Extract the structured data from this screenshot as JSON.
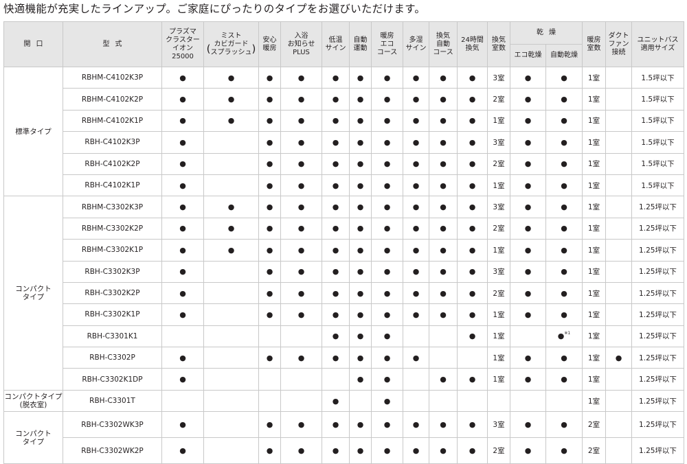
{
  "heading": "快適機能が充実したラインアップ。ご家庭にぴったりのタイプをお選びいただけます。",
  "columns": {
    "opening": [
      "開",
      "口"
    ],
    "model": [
      "型",
      "式"
    ],
    "plasma": [
      "プラズマ",
      "クラスター",
      "イオン",
      "25000"
    ],
    "mist": [
      "ミスト",
      "カビガード",
      "スプラッシュ"
    ],
    "anshin": [
      "安心",
      "暖房"
    ],
    "bath": [
      "入浴",
      "お知らせ",
      "PLUS"
    ],
    "low_temp": [
      "低温",
      "サイン"
    ],
    "auto": [
      "自動",
      "運動"
    ],
    "heat_eco": [
      "暖房",
      "エコ",
      "コース"
    ],
    "humid": [
      "多湿",
      "サイン"
    ],
    "vent_auto": [
      "換気",
      "自動",
      "コース"
    ],
    "vent24": [
      "24時間",
      "換気"
    ],
    "vent_rooms": [
      "換気",
      "室数"
    ],
    "dry": [
      "乾",
      "燥"
    ],
    "dry_eco": "エコ乾燥",
    "dry_auto": "自動乾燥",
    "heat_rooms": [
      "暖房",
      "室数"
    ],
    "duct": [
      "ダクト",
      "ファン",
      "接続"
    ],
    "size": [
      "ユニットバス",
      "適用サイズ"
    ]
  },
  "paren": [
    "(",
    ")"
  ],
  "dot": "●",
  "note_mark": "※1",
  "groups": [
    {
      "name": [
        "標準タイプ"
      ],
      "rows": [
        {
          "model": "RBHM-C4102K3P",
          "c": [
            "●",
            "●",
            "●",
            "●",
            "●",
            "●",
            "●",
            "●",
            "●",
            "●",
            "3室",
            "●",
            "●",
            "1室",
            "",
            "1.5坪以下"
          ]
        },
        {
          "model": "RBHM-C4102K2P",
          "c": [
            "●",
            "●",
            "●",
            "●",
            "●",
            "●",
            "●",
            "●",
            "●",
            "●",
            "2室",
            "●",
            "●",
            "1室",
            "",
            "1.5坪以下"
          ]
        },
        {
          "model": "RBHM-C4102K1P",
          "c": [
            "●",
            "●",
            "●",
            "●",
            "●",
            "●",
            "●",
            "●",
            "●",
            "●",
            "1室",
            "●",
            "●",
            "1室",
            "",
            "1.5坪以下"
          ]
        },
        {
          "model": "RBH-C4102K3P",
          "c": [
            "●",
            "",
            "●",
            "●",
            "●",
            "●",
            "●",
            "●",
            "●",
            "●",
            "3室",
            "●",
            "●",
            "1室",
            "",
            "1.5坪以下"
          ]
        },
        {
          "model": "RBH-C4102K2P",
          "c": [
            "●",
            "",
            "●",
            "●",
            "●",
            "●",
            "●",
            "●",
            "●",
            "●",
            "2室",
            "●",
            "●",
            "1室",
            "",
            "1.5坪以下"
          ]
        },
        {
          "model": "RBH-C4102K1P",
          "c": [
            "●",
            "",
            "●",
            "●",
            "●",
            "●",
            "●",
            "●",
            "●",
            "●",
            "1室",
            "●",
            "●",
            "1室",
            "",
            "1.5坪以下"
          ]
        }
      ]
    },
    {
      "name": [
        "コンパクト",
        "タイプ"
      ],
      "rows": [
        {
          "model": "RBHM-C3302K3P",
          "c": [
            "●",
            "●",
            "●",
            "●",
            "●",
            "●",
            "●",
            "●",
            "●",
            "●",
            "3室",
            "●",
            "●",
            "1室",
            "",
            "1.25坪以下"
          ]
        },
        {
          "model": "RBHM-C3302K2P",
          "c": [
            "●",
            "●",
            "●",
            "●",
            "●",
            "●",
            "●",
            "●",
            "●",
            "●",
            "2室",
            "●",
            "●",
            "1室",
            "",
            "1.25坪以下"
          ]
        },
        {
          "model": "RBHM-C3302K1P",
          "c": [
            "●",
            "●",
            "●",
            "●",
            "●",
            "●",
            "●",
            "●",
            "●",
            "●",
            "1室",
            "●",
            "●",
            "1室",
            "",
            "1.25坪以下"
          ]
        },
        {
          "model": "RBH-C3302K3P",
          "c": [
            "●",
            "",
            "●",
            "●",
            "●",
            "●",
            "●",
            "●",
            "●",
            "●",
            "3室",
            "●",
            "●",
            "1室",
            "",
            "1.25坪以下"
          ]
        },
        {
          "model": "RBH-C3302K2P",
          "c": [
            "●",
            "",
            "●",
            "●",
            "●",
            "●",
            "●",
            "●",
            "●",
            "●",
            "2室",
            "●",
            "●",
            "1室",
            "",
            "1.25坪以下"
          ]
        },
        {
          "model": "RBH-C3302K1P",
          "c": [
            "●",
            "",
            "●",
            "●",
            "●",
            "●",
            "●",
            "●",
            "●",
            "●",
            "1室",
            "●",
            "●",
            "1室",
            "",
            "1.25坪以下"
          ]
        },
        {
          "model": "RBH-C3301K1",
          "c": [
            "",
            "",
            "",
            "",
            "●",
            "●",
            "●",
            "",
            "",
            "●",
            "1室",
            "",
            "●",
            "1室",
            "",
            "1.25坪以下"
          ],
          "note_col": 12
        },
        {
          "model": "RBH-C3302P",
          "c": [
            "●",
            "",
            "●",
            "●",
            "●",
            "●",
            "●",
            "●",
            "",
            "",
            "1室",
            "●",
            "●",
            "1室",
            "●",
            "1.25坪以下"
          ]
        },
        {
          "model": "RBH-C3302K1DP",
          "c": [
            "●",
            "",
            "",
            "",
            "",
            "●",
            "●",
            "",
            "●",
            "●",
            "1室",
            "●",
            "●",
            "1室",
            "",
            "1.25坪以下"
          ]
        }
      ]
    },
    {
      "name": [
        "コンパクトタイプ",
        "(脱衣室)"
      ],
      "rows": [
        {
          "model": "RBH-C3301T",
          "c": [
            "",
            "",
            "",
            "",
            "●",
            "",
            "●",
            "",
            "",
            "",
            "",
            "",
            "",
            "1室",
            "",
            "1.25坪以下"
          ]
        }
      ]
    },
    {
      "name": [
        "コンパクト",
        "タイプ"
      ],
      "rows": [
        {
          "model": "RBH-C3302WK3P",
          "c": [
            "●",
            "",
            "●",
            "●",
            "●",
            "●",
            "●",
            "●",
            "●",
            "●",
            "3室",
            "●",
            "●",
            "2室",
            "",
            "1.25坪以下"
          ]
        },
        {
          "model": "RBH-C3302WK2P",
          "c": [
            "●",
            "",
            "●",
            "●",
            "●",
            "●",
            "●",
            "●",
            "●",
            "●",
            "2室",
            "●",
            "●",
            "2室",
            "",
            "1.25坪以下"
          ]
        }
      ]
    }
  ]
}
